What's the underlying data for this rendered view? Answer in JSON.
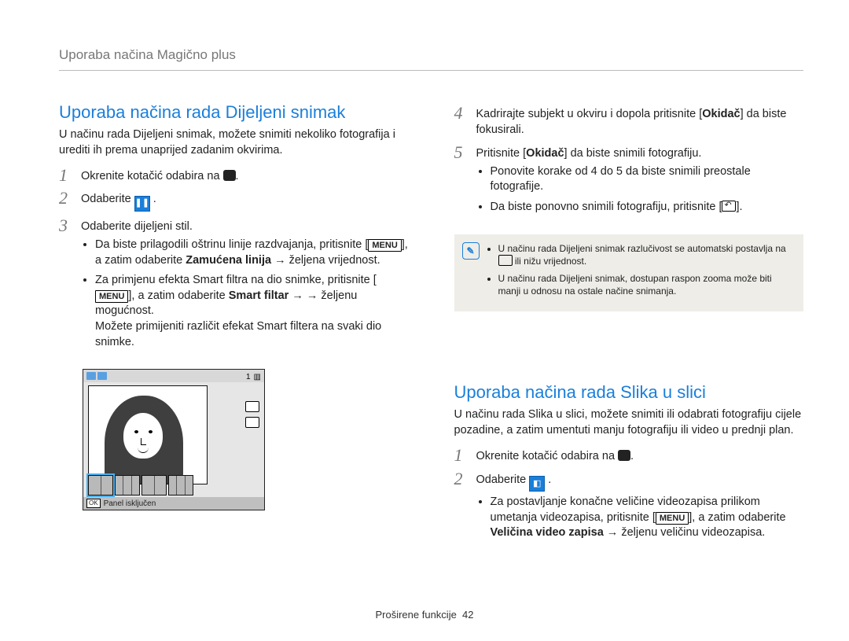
{
  "header": {
    "title": "Uporaba načina Magično plus"
  },
  "left": {
    "heading": "Uporaba načina rada Dijeljeni snimak",
    "intro": "U načinu rada Dijeljeni snimak, možete snimiti nekoliko fotografija i urediti ih prema unaprijed zadanim okvirima.",
    "s1": "Okrenite kotačić odabira na ",
    "s2": "Odaberite ",
    "s3": "Odaberite dijeljeni stil.",
    "b1a": "Da biste prilagodili oštrinu linije razdvajanja, pritisnite [",
    "b1menu": "MENU",
    "b1b": "], a zatim odaberite ",
    "b1bold": "Zamućena linija",
    "b1c": " → željena vrijednost.",
    "b2a": "Za primjenu efekta Smart filtra na dio snimke, pritisnite [",
    "b2menu": "MENU",
    "b2b": "], a zatim odaberite ",
    "b2bold": "Smart filtar",
    "b2c": " → → željenu mogućnost.",
    "b2d": "Možete primijeniti različit efekat Smart filtera na svaki dio snimke.",
    "shot_footer_ok": "OK",
    "shot_footer": "Panel isključen",
    "shot_counter": "1"
  },
  "right": {
    "s4a": "Kadrirajte subjekt u okviru i dopola pritisnite [",
    "s4bold": "Okidač",
    "s4b": "] da biste fokusirali.",
    "s5a": "Pritisnite [",
    "s5bold": "Okidač",
    "s5b": "] da biste snimili fotografiju.",
    "s5u1": "Ponovite korake od 4 do 5 da biste snimili preostale fotografije.",
    "s5u2a": "Da biste ponovno snimili fotografiju, pritisnite [",
    "s5u2b": "].",
    "note1a": "U načinu rada Dijeljeni snimak razlučivost se automatski postavlja na ",
    "note1b": " ili nižu vrijednost.",
    "note2": "U načinu rada Dijeljeni snimak, dostupan raspon zooma može biti manji u odnosu na ostale načine snimanja.",
    "heading2": "Uporaba načina rada Slika u slici",
    "intro2": "U načinu rada Slika u slici, možete snimiti ili odabrati fotografiju cijele pozadine, a zatim umentuti manju fotografiju ili video u prednji plan.",
    "p1": "Okrenite kotačić odabira na ",
    "p2": "Odaberite ",
    "p2u1a": "Za postavljanje konačne veličine videozapisa prilikom umetanja videozapisa, pritisnite [",
    "p2u1menu": "MENU",
    "p2u1b": "], a zatim odaberite ",
    "p2u1bold": "Veličina video zapisa",
    "p2u1c": " → željenu veličinu videozapisa."
  },
  "footer": {
    "section": "Proširene funkcije",
    "page": "42"
  }
}
